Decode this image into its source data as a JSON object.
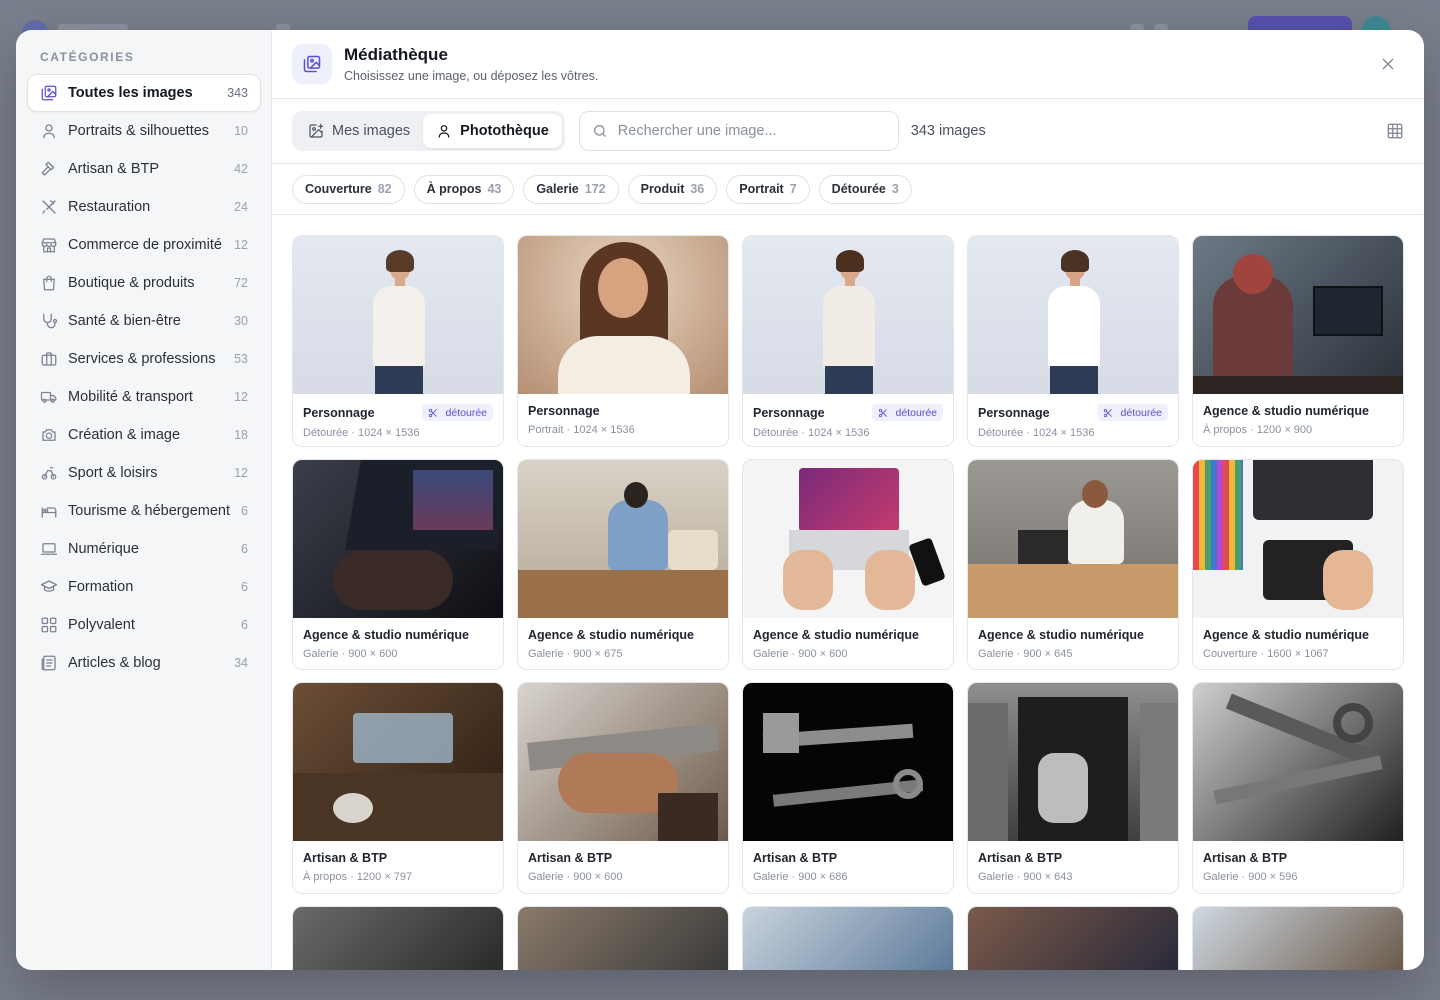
{
  "colors": {
    "accent": "#5b4fd6",
    "badge_bg": "#eef0fb"
  },
  "sidebar": {
    "title": "CATÉGORIES",
    "items": [
      {
        "label": "Toutes les images",
        "count": "343",
        "icon": "images-icon",
        "active": true
      },
      {
        "label": "Portraits & silhouettes",
        "count": "10",
        "icon": "person-icon"
      },
      {
        "label": "Artisan & BTP",
        "count": "42",
        "icon": "hammer-icon"
      },
      {
        "label": "Restauration",
        "count": "24",
        "icon": "utensils-icon"
      },
      {
        "label": "Commerce de proximité",
        "count": "12",
        "icon": "store-icon"
      },
      {
        "label": "Boutique & produits",
        "count": "72",
        "icon": "shopping-bag-icon"
      },
      {
        "label": "Santé & bien-être",
        "count": "30",
        "icon": "stethoscope-icon"
      },
      {
        "label": "Services & professions",
        "count": "53",
        "icon": "briefcase-icon"
      },
      {
        "label": "Mobilité & transport",
        "count": "12",
        "icon": "truck-icon"
      },
      {
        "label": "Création & image",
        "count": "18",
        "icon": "camera-icon"
      },
      {
        "label": "Sport & loisirs",
        "count": "12",
        "icon": "bike-icon"
      },
      {
        "label": "Tourisme & hébergement",
        "count": "6",
        "icon": "bed-icon"
      },
      {
        "label": "Numérique",
        "count": "6",
        "icon": "laptop-icon"
      },
      {
        "label": "Formation",
        "count": "6",
        "icon": "graduation-cap-icon"
      },
      {
        "label": "Polyvalent",
        "count": "6",
        "icon": "grid-icon"
      },
      {
        "label": "Articles & blog",
        "count": "34",
        "icon": "newspaper-icon"
      }
    ]
  },
  "header": {
    "title": "Médiathèque",
    "subtitle": "Choisissez une image, ou déposez les vôtres."
  },
  "toolbar": {
    "tabs": [
      {
        "label": "Mes images",
        "icon": "image-upload-icon",
        "active": false
      },
      {
        "label": "Photothèque",
        "icon": "person-icon",
        "active": true
      }
    ],
    "search_placeholder": "Rechercher une image...",
    "count": "343 images"
  },
  "chips": [
    {
      "label": "Couverture",
      "count": "82"
    },
    {
      "label": "À propos",
      "count": "43"
    },
    {
      "label": "Galerie",
      "count": "172"
    },
    {
      "label": "Produit",
      "count": "36"
    },
    {
      "label": "Portrait",
      "count": "7"
    },
    {
      "label": "Détourée",
      "count": "3"
    }
  ],
  "cards": [
    {
      "title": "Personnage",
      "sub": "Détourée · 1024 × 1536",
      "badge": "détourée"
    },
    {
      "title": "Personnage",
      "sub": "Portrait · 1024 × 1536"
    },
    {
      "title": "Personnage",
      "sub": "Détourée · 1024 × 1536",
      "badge": "détourée"
    },
    {
      "title": "Personnage",
      "sub": "Détourée · 1024 × 1536",
      "badge": "détourée"
    },
    {
      "title": "Agence & studio numérique",
      "sub": "À propos · 1200 × 900"
    },
    {
      "title": "Agence & studio numérique",
      "sub": "Galerie · 900 × 600"
    },
    {
      "title": "Agence & studio numérique",
      "sub": "Galerie · 900 × 675"
    },
    {
      "title": "Agence & studio numérique",
      "sub": "Galerie · 900 × 600"
    },
    {
      "title": "Agence & studio numérique",
      "sub": "Galerie · 900 × 645"
    },
    {
      "title": "Agence & studio numérique",
      "sub": "Couverture · 1600 × 1067"
    },
    {
      "title": "Artisan & BTP",
      "sub": "À propos · 1200 × 797"
    },
    {
      "title": "Artisan & BTP",
      "sub": "Galerie · 900 × 600"
    },
    {
      "title": "Artisan & BTP",
      "sub": "Galerie · 900 × 686"
    },
    {
      "title": "Artisan & BTP",
      "sub": "Galerie · 900 × 643"
    },
    {
      "title": "Artisan & BTP",
      "sub": "Galerie · 900 × 596"
    }
  ]
}
